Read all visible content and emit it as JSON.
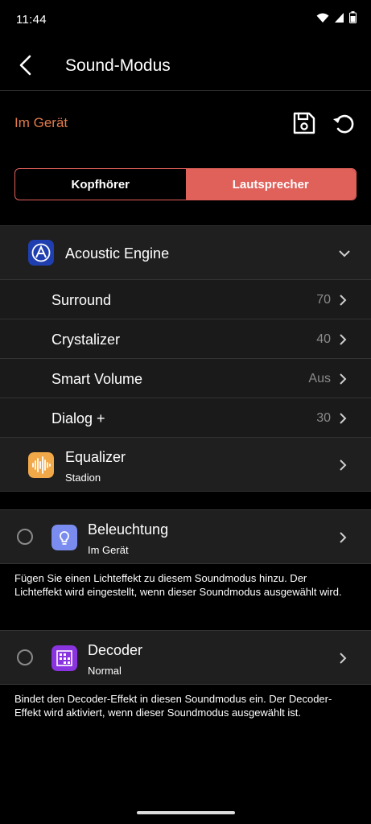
{
  "status": {
    "time": "11:44"
  },
  "header": {
    "title": "Sound-Modus"
  },
  "device": {
    "label": "Im Gerät"
  },
  "tabs": [
    {
      "label": "Kopfhörer",
      "active": false
    },
    {
      "label": "Lautsprecher",
      "active": true
    }
  ],
  "acoustic_engine": {
    "title": "Acoustic Engine",
    "items": [
      {
        "label": "Surround",
        "value": "70"
      },
      {
        "label": "Crystalizer",
        "value": "40"
      },
      {
        "label": "Smart Volume",
        "value": "Aus"
      },
      {
        "label": "Dialog +",
        "value": "30"
      }
    ]
  },
  "equalizer": {
    "title": "Equalizer",
    "subtitle": "Stadion"
  },
  "lighting": {
    "title": "Beleuchtung",
    "subtitle": "Im Gerät",
    "description": "Fügen Sie einen Lichteffekt zu diesem Soundmodus hinzu. Der Lichteffekt wird eingestellt, wenn dieser Soundmodus ausgewählt wird."
  },
  "decoder": {
    "title": "Decoder",
    "subtitle": "Normal",
    "description": "Bindet den Decoder-Effekt in diesen Soundmodus ein. Der Decoder-Effekt wird aktiviert, wenn dieser Soundmodus ausgewählt ist."
  },
  "colors": {
    "accent": "#e0605a",
    "device_label": "#e07a4a",
    "equalizer_icon": "#f0a848",
    "lighting_icon": "#7a8cf0",
    "decoder_icon": "#8a34e0",
    "acoustic_icon": "#1f3fb0"
  }
}
